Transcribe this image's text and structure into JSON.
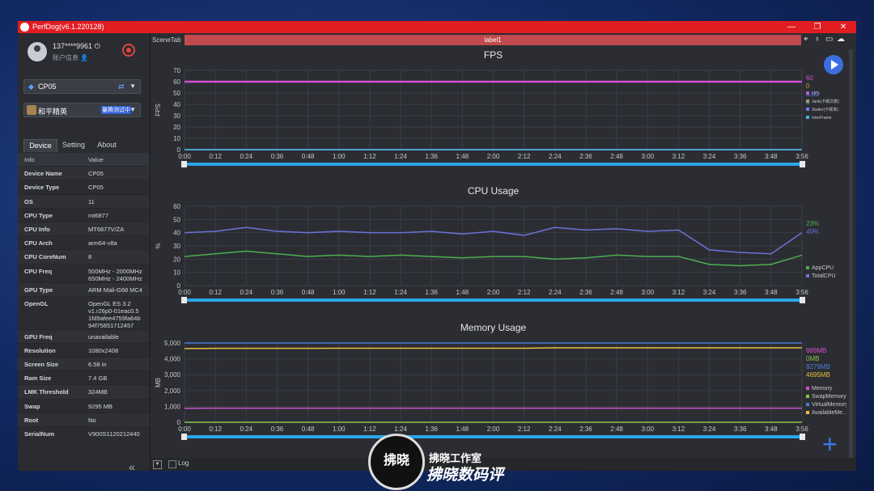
{
  "window": {
    "title": "PerfDog(v6.1.220128)",
    "min": "—",
    "max": "❐",
    "close": "✕"
  },
  "sidebar": {
    "user_id": "137****9961",
    "account_label": "账户信息",
    "device_dropdown": "CP05",
    "app_dropdown": "和平精英",
    "app_tag": "量腾测试中",
    "tabs": [
      "Device",
      "Setting",
      "About"
    ],
    "info_header": {
      "key": "Info",
      "value": "Value"
    },
    "info_rows": [
      {
        "k": "Device Name",
        "v": "CP05"
      },
      {
        "k": "Device Type",
        "v": "CP05"
      },
      {
        "k": "OS",
        "v": "11"
      },
      {
        "k": "CPU Type",
        "v": "mt6877"
      },
      {
        "k": "CPU Info",
        "v": "MT6877V/ZA"
      },
      {
        "k": "CPU Arch",
        "v": "arm64-v8a"
      },
      {
        "k": "CPU CoreNum",
        "v": "8"
      },
      {
        "k": "CPU Freq",
        "v": "500MHz - 2000MHz 650MHz - 2400MHz"
      },
      {
        "k": "GPU Type",
        "v": "ARM Mali-G68 MC4"
      },
      {
        "k": "OpenGL",
        "v": "OpenGL ES 3.2 v1.r26p0-01eac0.5 1fd9afee4759fa64b 94f75851712457"
      },
      {
        "k": "GPU Freq",
        "v": "unavailable"
      },
      {
        "k": "Resolution",
        "v": "1080x2408"
      },
      {
        "k": "Screen Size",
        "v": "6.58 in"
      },
      {
        "k": "Ram Size",
        "v": "7.4 GB"
      },
      {
        "k": "LMK Threshold",
        "v": "324MB"
      },
      {
        "k": "Swap",
        "v": "9295 MB"
      },
      {
        "k": "Root",
        "v": "No"
      },
      {
        "k": "SerialNum",
        "v": "V900S1120212440"
      }
    ]
  },
  "toolbar": {
    "scene_tab": "SceneTab",
    "label": "label1"
  },
  "bottom": {
    "log_label": "Log"
  },
  "watermark": {
    "line1": "拂晓工作室",
    "line2": "拂晓数码评",
    "badge": "拂晓"
  },
  "colors": {
    "titlebar": "#e11d22",
    "fps": "#d050d0",
    "jank": "#e58a2c",
    "stutter": "#6a7cf0",
    "interframe": "#3fb6e0",
    "appcpu": "#4caf50",
    "totalcpu": "#6b72d8",
    "memory": "#d050d0",
    "swap": "#8bc34a",
    "virtual": "#4f7cd6",
    "available": "#e8c13a",
    "slider": "#2aa6e8"
  },
  "chart_data": [
    {
      "type": "line",
      "title": "FPS",
      "ylabel": "FPS",
      "ylim": [
        0,
        70
      ],
      "yticks": [
        "70",
        "60",
        "50",
        "40",
        "30",
        "20",
        "10",
        "0"
      ],
      "xticks": [
        "0:00",
        "0:12",
        "0:24",
        "0:36",
        "0:48",
        "1:00",
        "1:12",
        "1:24",
        "1:36",
        "1:48",
        "2:00",
        "2:12",
        "2:24",
        "2:36",
        "2:48",
        "3:00",
        "3:12",
        "3:24",
        "3:36",
        "3:48",
        "3:56"
      ],
      "series": [
        {
          "name": "FPS",
          "current": "60",
          "values": [
            60,
            60,
            60,
            60,
            60,
            60,
            60,
            60,
            60,
            60,
            60,
            60,
            60,
            60,
            60,
            60,
            60,
            60,
            60,
            60,
            60
          ]
        },
        {
          "name": "Jank(卡顿次数)",
          "current": "0",
          "values": [
            0,
            0,
            0,
            0,
            0,
            0,
            0,
            0,
            0,
            0,
            0,
            0,
            0,
            0,
            0,
            0,
            0,
            0,
            0,
            0,
            0
          ]
        },
        {
          "name": "Stutter(卡顿率)",
          "current": "0.00",
          "values": [
            0,
            0,
            0,
            0,
            0,
            0,
            0,
            0,
            0,
            0,
            0,
            0,
            0,
            0,
            0,
            0,
            0,
            0,
            0,
            0,
            0
          ]
        },
        {
          "name": "InterFrame",
          "current": "0",
          "values": [
            0,
            0,
            0,
            0,
            0,
            0,
            0,
            0,
            0,
            0,
            0,
            0,
            0,
            0,
            0,
            0,
            0,
            0,
            0,
            0,
            0
          ]
        }
      ]
    },
    {
      "type": "line",
      "title": "CPU Usage",
      "ylabel": "%",
      "ylim": [
        0,
        60
      ],
      "yticks": [
        "60",
        "50",
        "40",
        "30",
        "20",
        "10",
        "0"
      ],
      "xticks": [
        "0:00",
        "0:12",
        "0:24",
        "0:36",
        "0:48",
        "1:00",
        "1:12",
        "1:24",
        "1:36",
        "1:48",
        "2:00",
        "2:12",
        "2:24",
        "2:36",
        "2:48",
        "3:00",
        "3:12",
        "3:24",
        "3:36",
        "3:48",
        "3:56"
      ],
      "series": [
        {
          "name": "AppCPU",
          "current": "23%",
          "values": [
            22,
            24,
            26,
            24,
            22,
            23,
            22,
            23,
            22,
            21,
            22,
            22,
            20,
            21,
            23,
            22,
            22,
            16,
            15,
            16,
            23
          ]
        },
        {
          "name": "TotalCPU",
          "current": "40%",
          "values": [
            40,
            41,
            44,
            41,
            40,
            41,
            40,
            40,
            41,
            39,
            41,
            38,
            44,
            42,
            43,
            41,
            42,
            27,
            25,
            24,
            40
          ]
        }
      ]
    },
    {
      "type": "line",
      "title": "Memory Usage",
      "ylabel": "MB",
      "ylim": [
        0,
        5000
      ],
      "yticks": [
        "5,000",
        "4,000",
        "3,000",
        "2,000",
        "1,000",
        "0"
      ],
      "xticks": [
        "0:00",
        "0:12",
        "0:24",
        "0:36",
        "0:48",
        "1:00",
        "1:12",
        "1:24",
        "1:36",
        "1:48",
        "2:00",
        "2:12",
        "2:24",
        "2:36",
        "2:48",
        "3:00",
        "3:12",
        "3:24",
        "3:36",
        "3:48",
        "3:56"
      ],
      "series": [
        {
          "name": "Memory",
          "current": "889MB",
          "values": [
            880,
            885,
            888,
            889,
            889,
            889,
            889,
            889,
            889,
            889,
            889,
            889,
            889,
            889,
            889,
            889,
            889,
            889,
            889,
            889,
            889
          ]
        },
        {
          "name": "SwapMemory",
          "current": "0MB",
          "values": [
            0,
            0,
            0,
            0,
            0,
            0,
            0,
            0,
            0,
            0,
            0,
            0,
            0,
            0,
            0,
            0,
            0,
            0,
            0,
            0,
            0
          ]
        },
        {
          "name": "VirtualMemory",
          "current": "8279MB",
          "values": [
            8279,
            8279,
            8279,
            8279,
            8279,
            8279,
            8279,
            8279,
            8279,
            8279,
            8279,
            8279,
            8279,
            8279,
            8279,
            8279,
            8279,
            8279,
            8279,
            8279,
            8279
          ]
        },
        {
          "name": "AvailableMe...",
          "current": "4695MB",
          "values": [
            4650,
            4660,
            4665,
            4665,
            4665,
            4670,
            4670,
            4670,
            4670,
            4670,
            4670,
            4670,
            4695,
            4695,
            4695,
            4695,
            4695,
            4695,
            4695,
            4695,
            4695
          ]
        }
      ]
    }
  ]
}
